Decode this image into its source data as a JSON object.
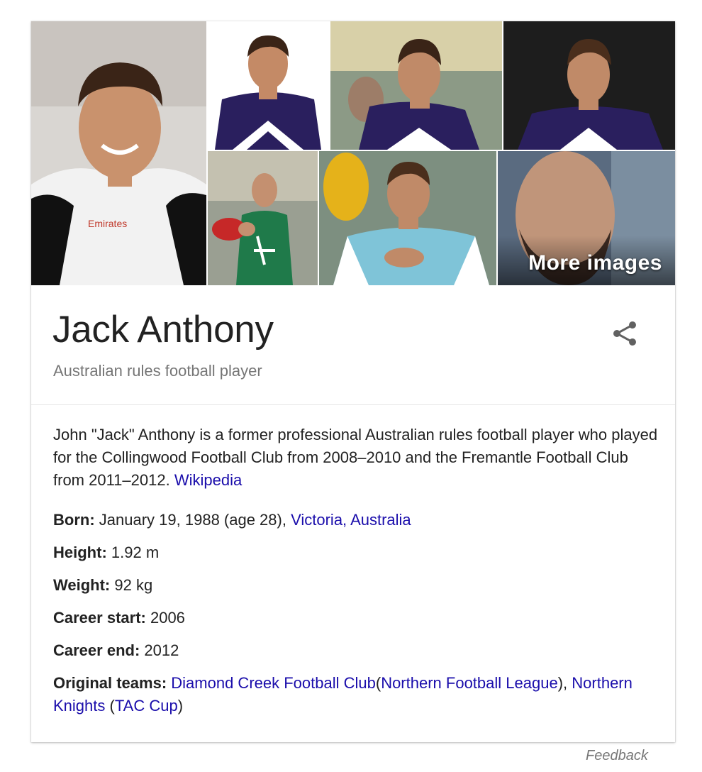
{
  "gallery": {
    "more_images_label": "More images",
    "images": [
      {
        "name": "photo-collingwood-portrait"
      },
      {
        "name": "photo-fremantle-headshot"
      },
      {
        "name": "photo-fremantle-action-1"
      },
      {
        "name": "photo-fremantle-action-2"
      },
      {
        "name": "photo-green-guernsey-training"
      },
      {
        "name": "photo-training-football"
      },
      {
        "name": "photo-bearded-closeup"
      }
    ]
  },
  "entity": {
    "title": "Jack Anthony",
    "subtitle": "Australian rules football player",
    "description": "John \"Jack\" Anthony is a former professional Australian rules football player who played for the Collingwood Football Club from 2008–2010 and the Fremantle Football Club from 2011–2012.",
    "source_link": "Wikipedia"
  },
  "facts": {
    "born": {
      "label": "Born:",
      "value": "January 19, 1988 (age 28),",
      "link": "Victoria, Australia"
    },
    "height": {
      "label": "Height:",
      "value": "1.92 m"
    },
    "weight": {
      "label": "Weight:",
      "value": "92 kg"
    },
    "career_start": {
      "label": "Career start:",
      "value": "2006"
    },
    "career_end": {
      "label": "Career end:",
      "value": "2012"
    },
    "original_teams": {
      "label": "Original teams:",
      "team1": "Diamond Creek Football Club",
      "open1": "(",
      "league1": "Northern Football League",
      "close1": "),",
      "team2": "Northern Knights",
      "open2": "(",
      "league2": "TAC Cup",
      "close2": ")"
    }
  },
  "feedback_label": "Feedback",
  "colors": {
    "link": "#1a0dab",
    "subtitle": "#757575",
    "fremantle_purple": "#2a1f5e",
    "collingwood_black": "#111111"
  },
  "icons": {
    "share": "share-icon"
  }
}
